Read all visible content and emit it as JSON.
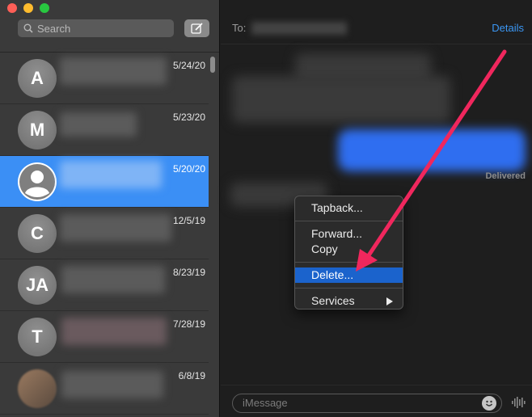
{
  "sidebar": {
    "search_placeholder": "Search",
    "conversations": [
      {
        "initials": "A",
        "date": "5/24/20"
      },
      {
        "initials": "M",
        "date": "5/23/20"
      },
      {
        "initials": "",
        "date": "5/20/20",
        "selected": true
      },
      {
        "initials": "C",
        "date": "12/5/19"
      },
      {
        "initials": "JA",
        "date": "8/23/19"
      },
      {
        "initials": "T",
        "date": "7/28/19"
      },
      {
        "initials": "",
        "date": "6/8/19"
      }
    ]
  },
  "header": {
    "to_label": "To:",
    "details_label": "Details"
  },
  "messages": {
    "delivered_label": "Delivered"
  },
  "context_menu": {
    "tapback": "Tapback...",
    "forward": "Forward...",
    "copy": "Copy",
    "delete": "Delete...",
    "services": "Services"
  },
  "composer": {
    "placeholder": "iMessage"
  },
  "colors": {
    "accent": "#3b8ff5",
    "menu_highlight": "#1b63cc",
    "annotation_arrow": "#f0275d",
    "link": "#3b97f4"
  },
  "icons": {
    "search": "search-icon",
    "compose": "compose-icon",
    "emoji": "emoji-icon",
    "audio": "audio-waveform-icon",
    "submenu": "chevron-right-icon",
    "person": "person-silhouette-icon"
  }
}
